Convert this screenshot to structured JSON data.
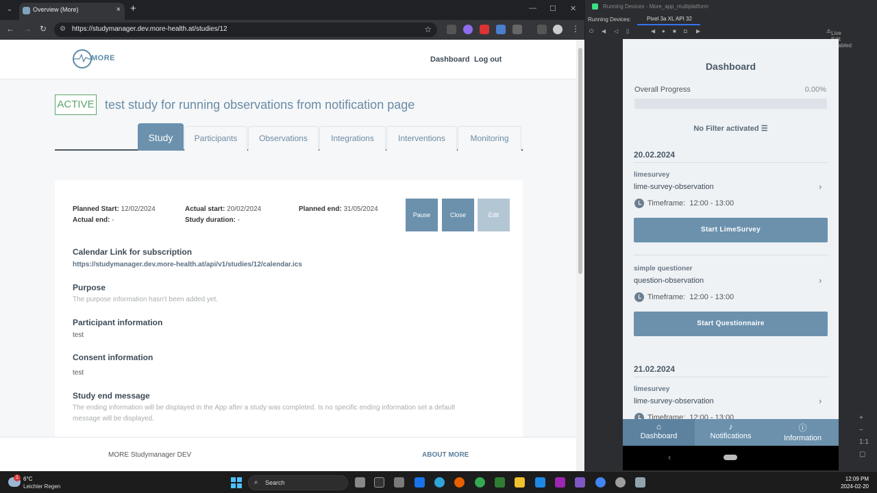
{
  "browser": {
    "tab_title": "Overview (More)",
    "url": "https://studymanager.dev.more-health.at/studies/12"
  },
  "site": {
    "logo_text": "MORE",
    "nav": {
      "dashboard": "Dashboard",
      "logout": "Log out"
    },
    "status_badge": "ACTIVE",
    "study_title": "test study for running observations from notification page",
    "tabs": [
      "Study",
      "Participants",
      "Observations",
      "Integrations",
      "Interventions",
      "Monitoring"
    ],
    "details": {
      "planned_start_label": "Planned Start:",
      "planned_start": "12/02/2024",
      "actual_start_label": "Actual start:",
      "actual_start": "20/02/2024",
      "planned_end_label": "Planned end:",
      "planned_end": "31/05/2024",
      "actual_end_label": "Actual end:",
      "actual_end": "-",
      "duration_label": "Study duration:",
      "duration": "-"
    },
    "actions": {
      "pause": "Pause",
      "close": "Close",
      "edit": "Edit"
    },
    "sections": {
      "calendar_h": "Calendar Link for subscription",
      "calendar_link": "https://studymanager.dev.more-health.at/api/v1/studies/12/calendar.ics",
      "purpose_h": "Purpose",
      "purpose_t": "The purpose information hasn't been added yet.",
      "participant_h": "Participant information",
      "participant_t": "test",
      "consent_h": "Consent information",
      "consent_t": "test",
      "end_h": "Study end message",
      "end_t1": "The ending information will be displayed in the App after a study was completed. Is no specific ending information set a default",
      "end_t2": "message will be displayed."
    },
    "footer": {
      "left": "MORE Studymanager DEV",
      "right": "ABOUT MORE"
    }
  },
  "emulator": {
    "window_title": "Running Devices - More_app_multiplatform",
    "label": "Running Devices:",
    "device_tab": "Pixel 3a XL API 32",
    "live_edit": "Live Edit disabled"
  },
  "app": {
    "title": "Dashboard",
    "progress_label": "Overall Progress",
    "progress_value": "0.00%",
    "progress_fraction": 0.0,
    "filter": "No Filter activated",
    "timeframe_label": "Timeframe:",
    "day1": "20.02.2024",
    "obs1_type": "limesurvey",
    "obs1_name": "lime-survey-observation",
    "obs1_time": "12:00 - 13:00",
    "obs1_btn": "Start LimeSurvey",
    "obs2_type": "simple questioner",
    "obs2_name": "question-observation",
    "obs2_time": "12:00 - 13:00",
    "obs2_btn": "Start Questionnaire",
    "day2": "21.02.2024",
    "obs3_type": "limesurvey",
    "obs3_name": "lime-survey-observation",
    "obs3_time": "12:00 - 13:00",
    "nav": [
      "Dashboard",
      "Notifications",
      "Information"
    ]
  },
  "taskbar": {
    "temp": "6°C",
    "weather": "Leichter Regen",
    "weather_badge": "1",
    "search": "Search",
    "time": "12:09 PM",
    "date": "2024-02-20"
  },
  "colors": {
    "accent": "#6b91ad",
    "active_green": "#5aa56c",
    "title_blue": "#6a8aa4"
  }
}
